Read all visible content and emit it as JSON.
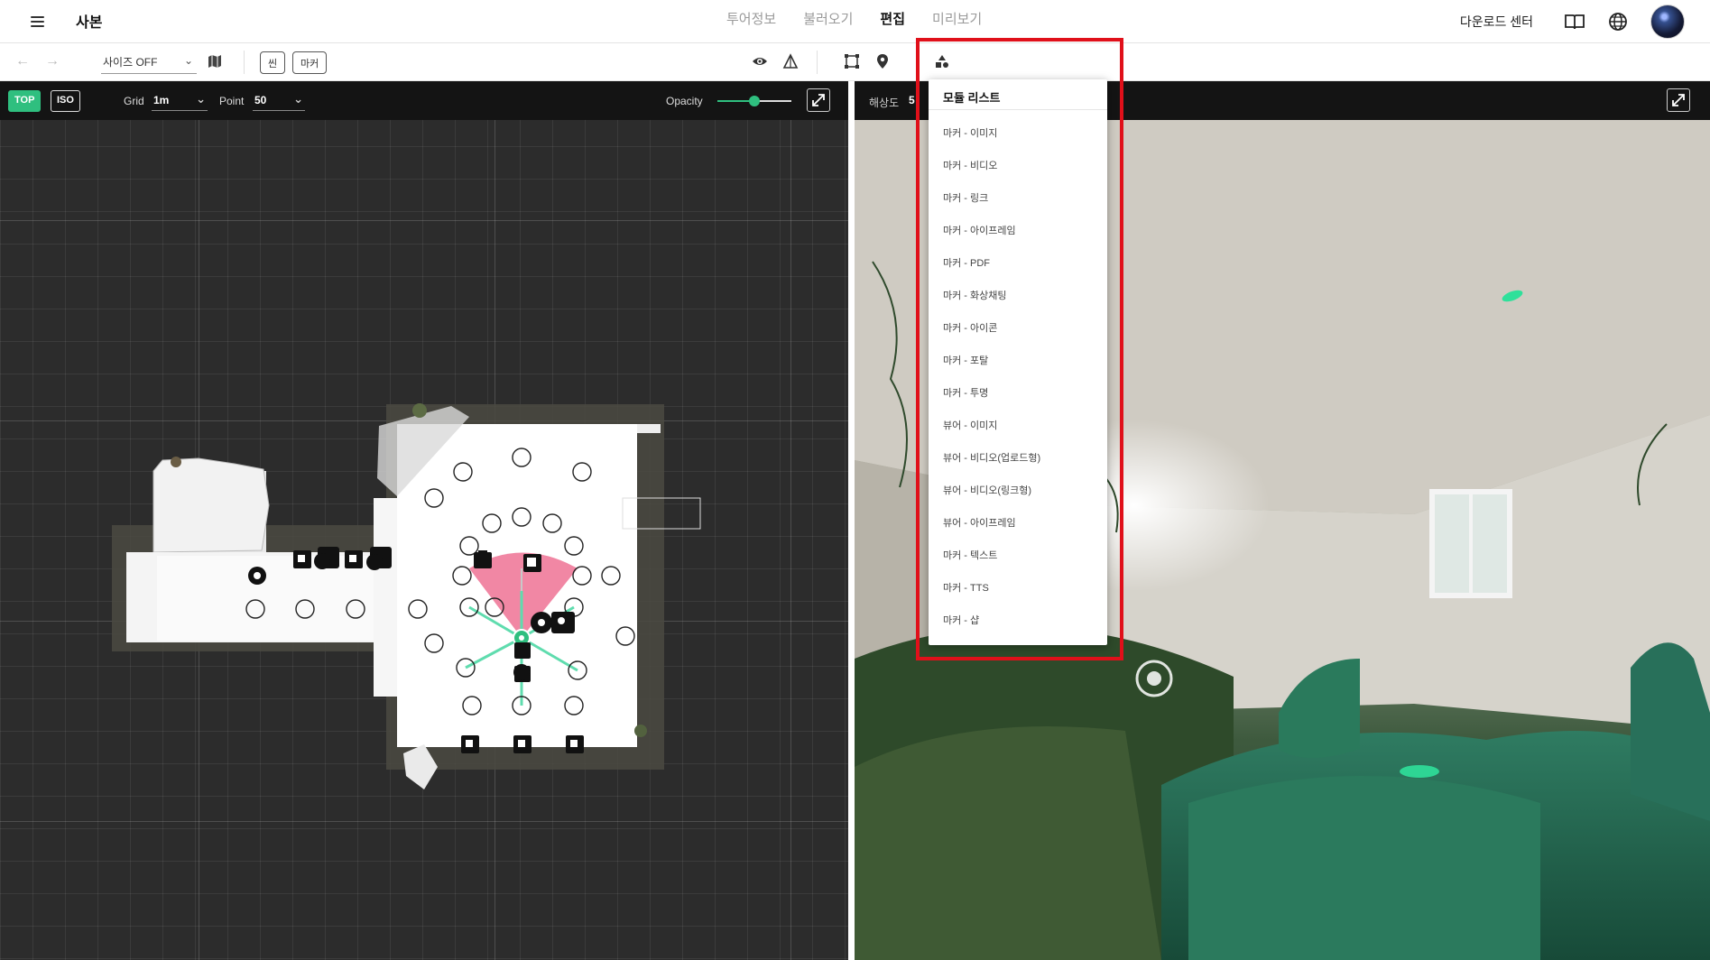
{
  "header": {
    "menu_icon": "hamburger-menu-icon",
    "title": "사본",
    "tabs": [
      {
        "label": "투어정보",
        "active": false
      },
      {
        "label": "불러오기",
        "active": false
      },
      {
        "label": "편집",
        "active": true
      },
      {
        "label": "미리보기",
        "active": false
      }
    ],
    "download_center": "다운로드 센터",
    "icons": [
      "book-icon",
      "globe-icon"
    ]
  },
  "toolbar": {
    "size_select": "사이즈 OFF",
    "scene_button": "씬",
    "marker_button": "마커"
  },
  "floorplan": {
    "view_top": "TOP",
    "view_iso": "ISO",
    "grid_label": "Grid",
    "grid_value": "1m",
    "point_label": "Point",
    "point_value": "50",
    "opacity_label": "Opacity",
    "opacity_value": 0.5
  },
  "viewer": {
    "resolution_label": "해상도",
    "resolution_value": "5"
  },
  "module_list": {
    "title": "모듈 리스트",
    "items": [
      "마커 - 이미지",
      "마커 - 비디오",
      "마커 - 링크",
      "마커 - 아이프레임",
      "마커 - PDF",
      "마커 - 화상채팅",
      "마커 - 아이콘",
      "마커 - 포탈",
      "마커 - 투명",
      "뷰어 - 이미지",
      "뷰어 - 비디오(업로드형)",
      "뷰어 - 비디오(링크형)",
      "뷰어 - 아이프레임",
      "마커 - 텍스트",
      "마커 - TTS",
      "마커 - 샵"
    ]
  },
  "colors": {
    "accent_green": "#2fbf7f",
    "highlight_red": "#e0101a",
    "fov_pink": "#f07a9a"
  }
}
